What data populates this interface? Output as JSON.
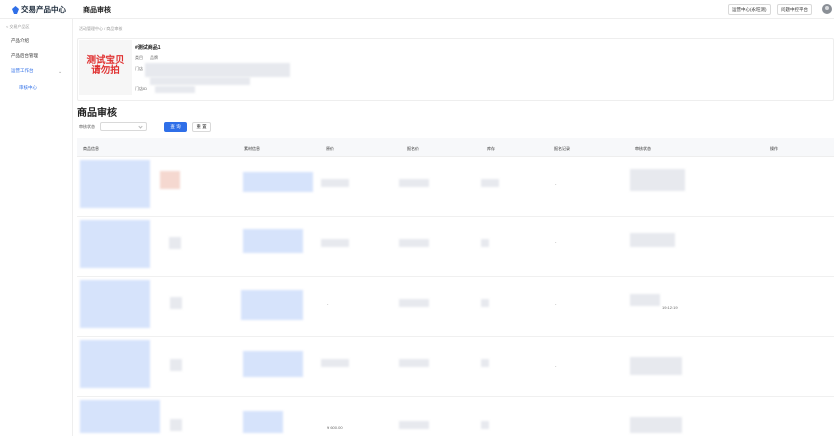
{
  "header": {
    "logo_text": "交易产品中心",
    "page_title": "商品审核",
    "btn_settlement": "运营中心(永旺测)",
    "btn_download": "问题中控平台"
  },
  "sidebar": {
    "back": "< 交易产品区",
    "items": [
      "产品介绍",
      "产品后台管理",
      "运营工作台",
      "审核中心"
    ]
  },
  "breadcrumb": "活动管理中心  /  商品审核",
  "product": {
    "name": "#测试商品1",
    "watermark_line1": "测试宝贝",
    "watermark_line2": "请勿拍",
    "labels": [
      "类目",
      "品牌",
      "门店",
      "门店ID"
    ]
  },
  "section_title": "商品审核",
  "filter": {
    "label": "审核状态",
    "query": "查 询",
    "reset": "重 置"
  },
  "table": {
    "columns": [
      "商品信息",
      "素材信息",
      "原价",
      "报名价",
      "库存",
      "报名记录",
      "审核状态",
      "操作"
    ],
    "rows": [
      {
        "price": "",
        "record": "-",
        "status": ""
      },
      {
        "price": "",
        "record": "-",
        "status": ""
      },
      {
        "price": "-",
        "record": "-",
        "status": "19:12:19"
      },
      {
        "price": "",
        "record": "-",
        "status": ""
      },
      {
        "price": "¥ 600.00",
        "record": "",
        "status": ""
      }
    ]
  },
  "colors": {
    "accent": "#2f6fe8",
    "watermark": "#e03030"
  }
}
